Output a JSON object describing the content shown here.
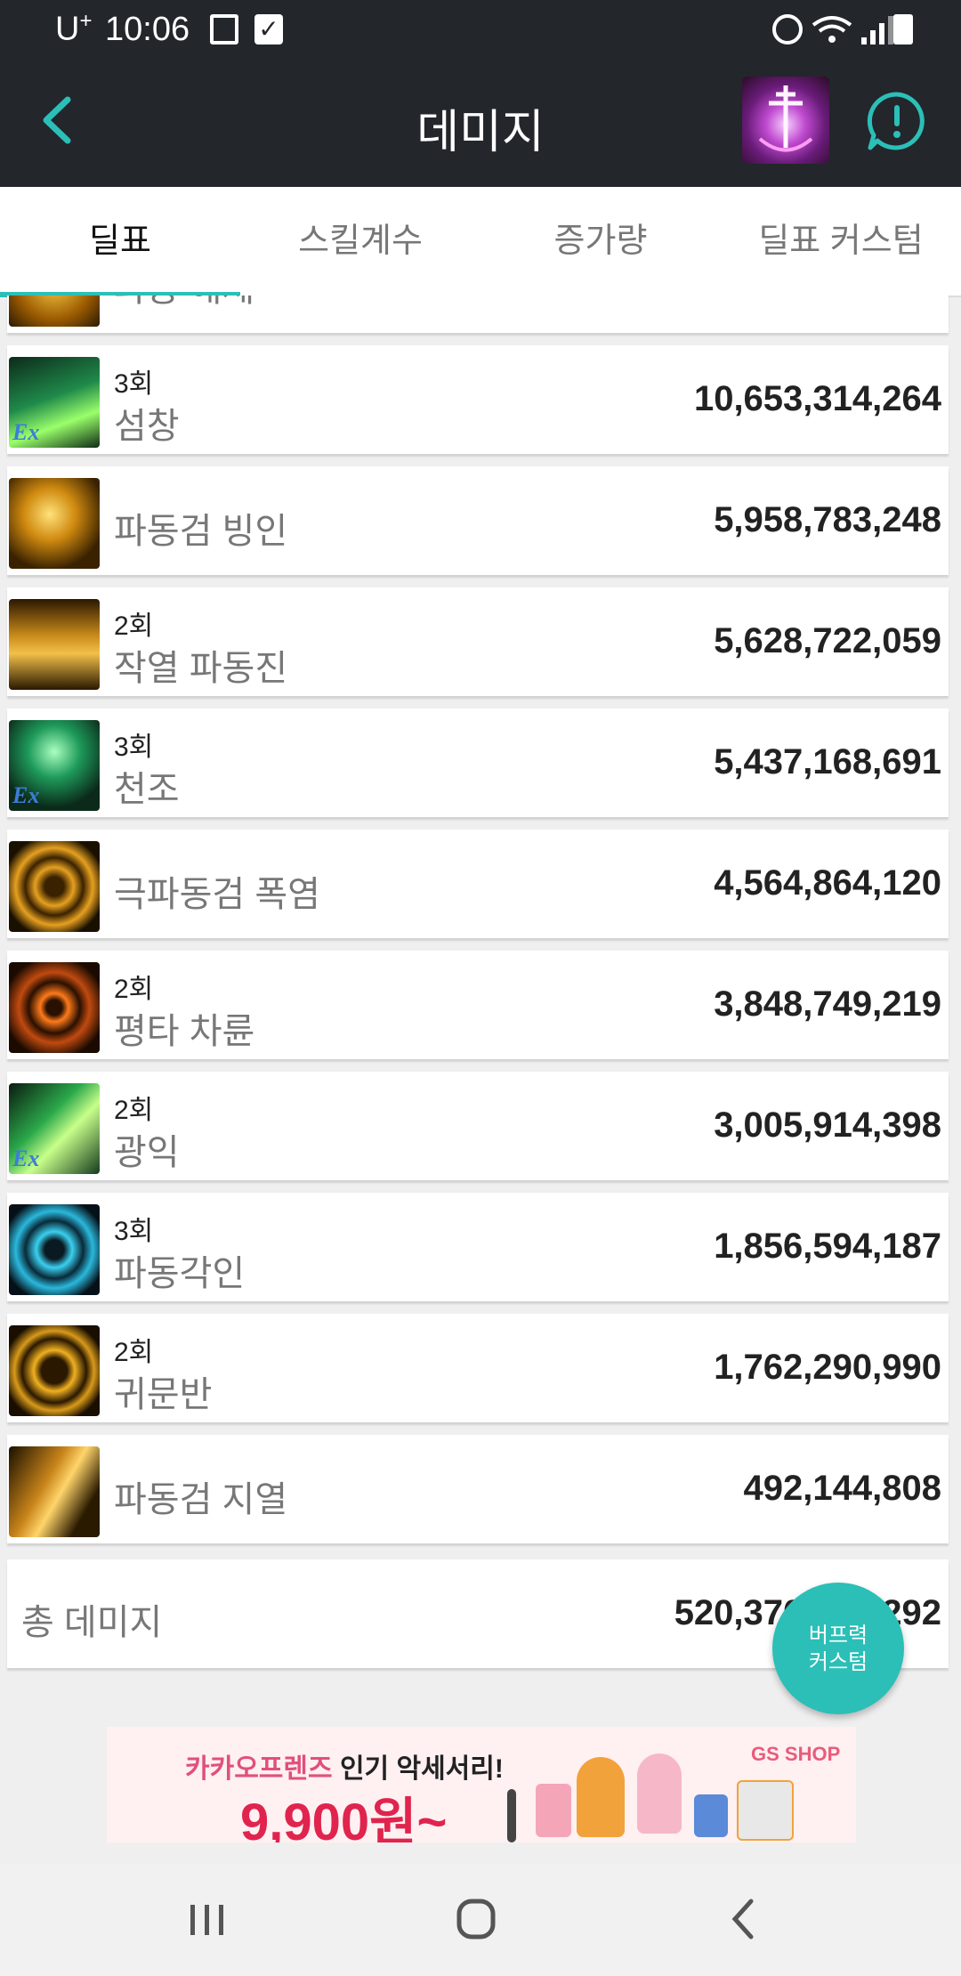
{
  "status_bar": {
    "carrier": "U",
    "carrier_sup": "+",
    "time": "10:06"
  },
  "header": {
    "title": "데미지"
  },
  "tabs": [
    {
      "label": "딜표",
      "active": true
    },
    {
      "label": "스킬계수",
      "active": false
    },
    {
      "label": "증가량",
      "active": false
    },
    {
      "label": "딜표 커스텀",
      "active": false
    }
  ],
  "partial_row": {
    "name": "파동 해제"
  },
  "skills": [
    {
      "hits": "3회",
      "name": "섬창",
      "value": "10,653,314,264",
      "icon": "green-flame-ex-icon"
    },
    {
      "hits": "",
      "name": "파동검 빙인",
      "value": "5,958,783,248",
      "icon": "golden-cross-icon"
    },
    {
      "hits": "2회",
      "name": "작열 파동진",
      "value": "5,628,722,059",
      "icon": "golden-figure-icon"
    },
    {
      "hits": "3회",
      "name": "천조",
      "value": "5,437,168,691",
      "icon": "green-cross-ex-icon"
    },
    {
      "hits": "",
      "name": "극파동검 폭염",
      "value": "4,564,864,120",
      "icon": "golden-orb-icon"
    },
    {
      "hits": "2회",
      "name": "평타 차륜",
      "value": "3,848,749,219",
      "icon": "orange-eye-icon"
    },
    {
      "hits": "2회",
      "name": "광익",
      "value": "3,005,914,398",
      "icon": "green-wing-ex-icon"
    },
    {
      "hits": "3회",
      "name": "파동각인",
      "value": "1,856,594,187",
      "icon": "cyan-seal-icon"
    },
    {
      "hits": "2회",
      "name": "귀문반",
      "value": "1,762,290,990",
      "icon": "golden-rune-icon"
    },
    {
      "hits": "",
      "name": "파동검 지열",
      "value": "492,144,808",
      "icon": "golden-wave-icon"
    }
  ],
  "total": {
    "label": "총 데미지",
    "value": "520,370",
    "value_tail": "292"
  },
  "fab": {
    "line1": "버프력",
    "line2": "커스텀"
  },
  "ad": {
    "line1_a": "카카오프렌즈",
    "line1_b": " 인기 악세서리!",
    "price": "9,900원~",
    "brand": "GS SHOP"
  },
  "ex_label": "Ex"
}
